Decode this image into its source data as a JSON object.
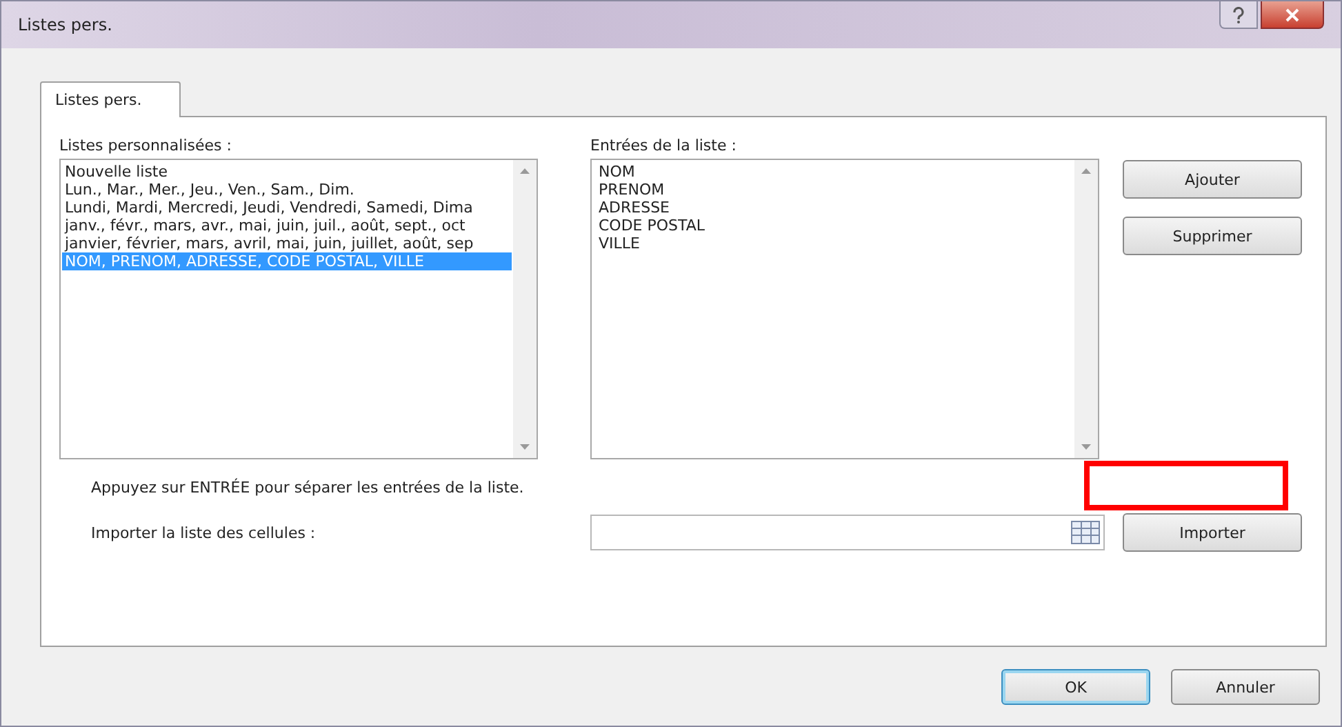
{
  "window": {
    "title": "Listes pers."
  },
  "tabs": [
    {
      "label": "Listes pers.",
      "selected": true
    }
  ],
  "custom_lists": {
    "label": "Listes personnalisées :",
    "items": [
      {
        "text": "Nouvelle liste",
        "selected": false
      },
      {
        "text": "Lun., Mar., Mer., Jeu., Ven., Sam., Dim.",
        "selected": false
      },
      {
        "text": "Lundi, Mardi, Mercredi, Jeudi, Vendredi, Samedi, Dima",
        "selected": false
      },
      {
        "text": "janv., févr., mars, avr., mai, juin, juil., août, sept., oct",
        "selected": false
      },
      {
        "text": "janvier, février, mars, avril, mai, juin, juillet, août, sep",
        "selected": false
      },
      {
        "text": "NOM, PRENOM, ADRESSE, CODE POSTAL, VILLE",
        "selected": true
      }
    ]
  },
  "list_entries": {
    "label": "Entrées de la liste :",
    "items": [
      "NOM",
      "PRENOM",
      "ADRESSE",
      "CODE POSTAL",
      "VILLE"
    ]
  },
  "side_buttons": [
    "Ajouter",
    "Supprimer"
  ],
  "hint": "Appuyez sur ENTRÉE pour séparer les entrées de la liste.",
  "import": {
    "label": "Importer la liste des cellules :",
    "button": "Importer"
  },
  "footer_buttons": [
    {
      "label": "OK",
      "default": true
    },
    {
      "label": "Annuler",
      "default": false
    }
  ]
}
